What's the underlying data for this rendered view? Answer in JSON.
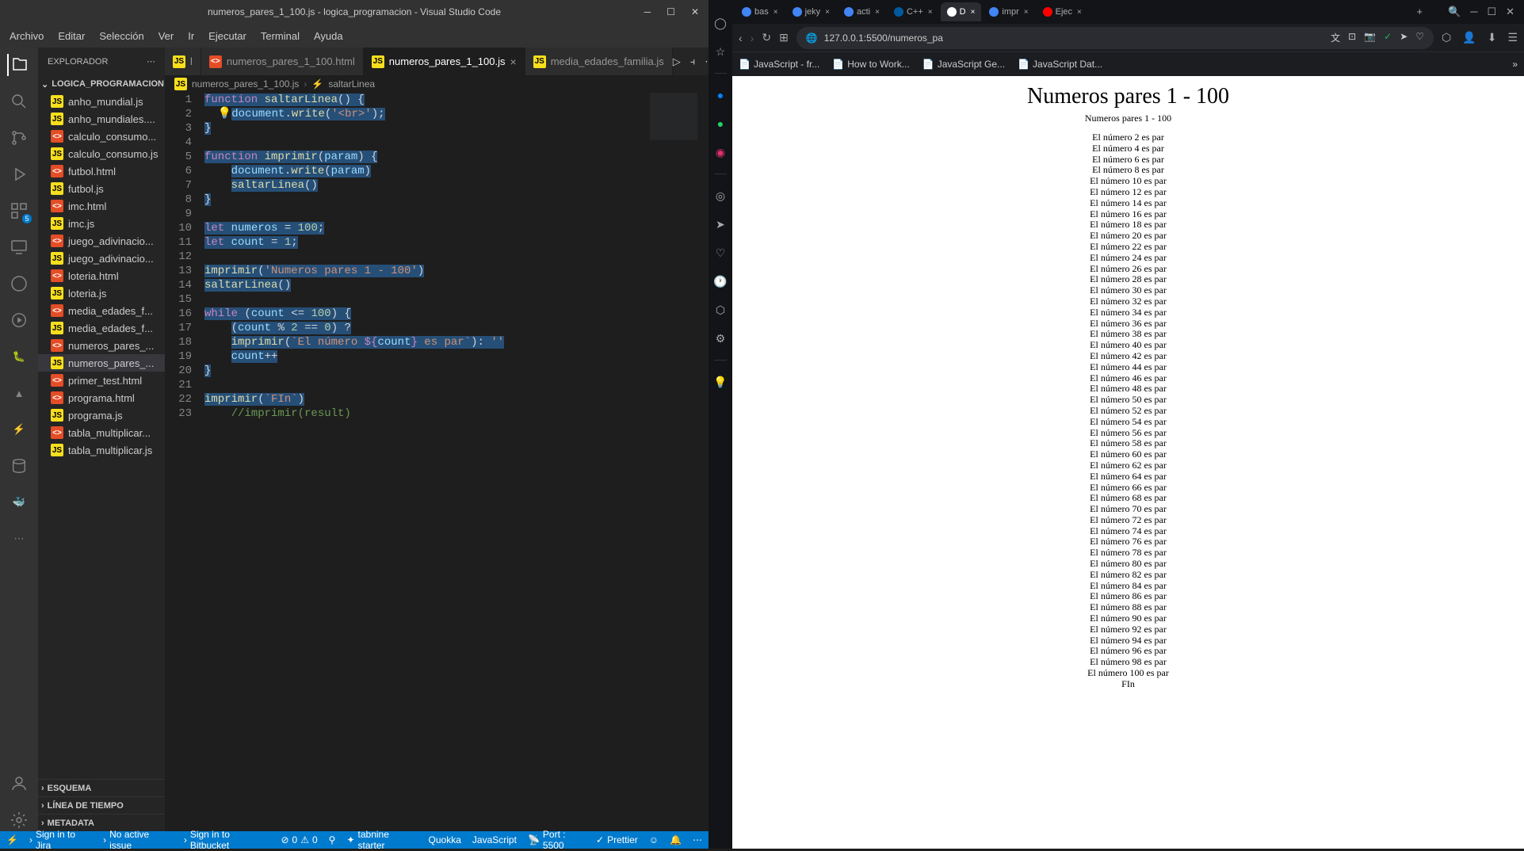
{
  "vscode": {
    "title": "numeros_pares_1_100.js - logica_programacion - Visual Studio Code",
    "menu": [
      "Archivo",
      "Editar",
      "Selección",
      "Ver",
      "Ir",
      "Ejecutar",
      "Terminal",
      "Ayuda"
    ],
    "explorer_label": "EXPLORADOR",
    "folder_name": "LOGICA_PROGRAMACION",
    "files": [
      {
        "name": "anho_mundial.js",
        "type": "js"
      },
      {
        "name": "anho_mundiales....",
        "type": "js"
      },
      {
        "name": "calculo_consumo...",
        "type": "html"
      },
      {
        "name": "calculo_consumo.js",
        "type": "js"
      },
      {
        "name": "futbol.html",
        "type": "html"
      },
      {
        "name": "futbol.js",
        "type": "js"
      },
      {
        "name": "imc.html",
        "type": "html"
      },
      {
        "name": "imc.js",
        "type": "js"
      },
      {
        "name": "juego_adivinacio...",
        "type": "html"
      },
      {
        "name": "juego_adivinacio...",
        "type": "js"
      },
      {
        "name": "loteria.html",
        "type": "html"
      },
      {
        "name": "loteria.js",
        "type": "js"
      },
      {
        "name": "media_edades_f...",
        "type": "html"
      },
      {
        "name": "media_edades_f...",
        "type": "js"
      },
      {
        "name": "numeros_pares_...",
        "type": "html"
      },
      {
        "name": "numeros_pares_...",
        "type": "js",
        "active": true
      },
      {
        "name": "primer_test.html",
        "type": "html"
      },
      {
        "name": "programa.html",
        "type": "html"
      },
      {
        "name": "programa.js",
        "type": "js"
      },
      {
        "name": "tabla_multiplicar...",
        "type": "html"
      },
      {
        "name": "tabla_multiplicar.js",
        "type": "js"
      }
    ],
    "sections": [
      "ESQUEMA",
      "LÍNEA DE TIEMPO",
      "METADATA"
    ],
    "tabs": [
      {
        "name": "l",
        "type": "js"
      },
      {
        "name": "numeros_pares_1_100.html",
        "type": "html"
      },
      {
        "name": "numeros_pares_1_100.js",
        "type": "js",
        "active": true
      },
      {
        "name": "media_edades_familia.js",
        "type": "js"
      }
    ],
    "breadcrumb": [
      "numeros_pares_1_100.js",
      "saltarLinea"
    ],
    "statusbar": {
      "jira": "Sign in to Jira",
      "issue": "No active issue",
      "bitbucket": "Sign in to Bitbucket",
      "errors": "0",
      "warnings": "0",
      "tabnine": "tabnine starter",
      "quokka": "Quokka",
      "lang": "JavaScript",
      "port": "Port : 5500",
      "prettier": "Prettier"
    }
  },
  "browser": {
    "tabs": [
      {
        "label": "bas",
        "icon": "#4285f4"
      },
      {
        "label": "jeky",
        "icon": "#4285f4"
      },
      {
        "label": "acti",
        "icon": "#4285f4"
      },
      {
        "label": "C++",
        "icon": "#00599c"
      },
      {
        "label": "D",
        "icon": "#fff",
        "active": true
      },
      {
        "label": "impr",
        "icon": "#4285f4"
      },
      {
        "label": "Ejec",
        "icon": "#ff0000"
      }
    ],
    "url": "127.0.0.1:5500/numeros_pa",
    "bookmarks": [
      "JavaScript - fr...",
      "How to Work...",
      "JavaScript Ge...",
      "JavaScript Dat..."
    ],
    "page": {
      "h1": "Numeros pares 1 - 100",
      "sub": "Numeros pares 1 - 100",
      "line_prefix": "El número ",
      "line_suffix": " es par",
      "fin": "FIn",
      "start": 2,
      "end": 100
    }
  }
}
